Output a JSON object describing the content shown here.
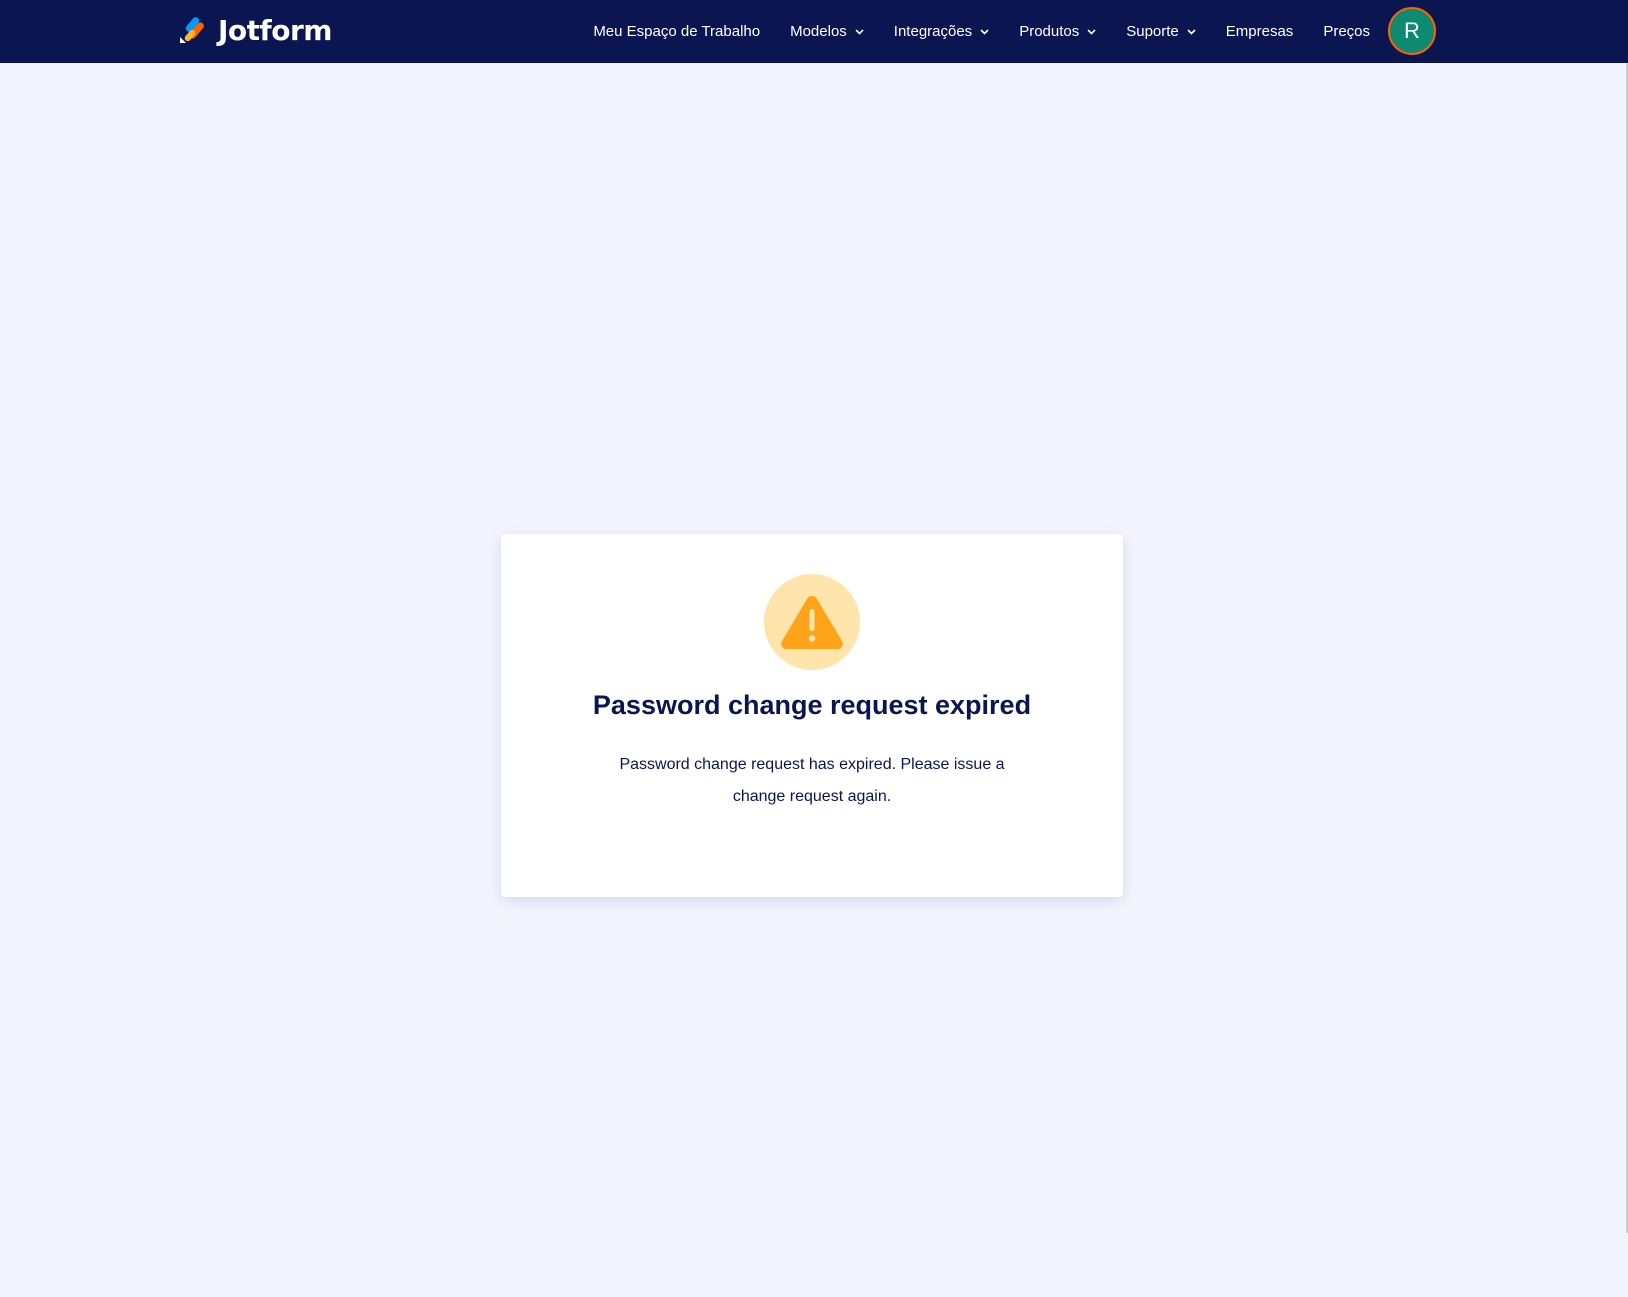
{
  "header": {
    "logo_text": "Jotform",
    "logo_icon": "jotform-logo-icon",
    "nav": [
      {
        "label": "Meu Espaço de Trabalho",
        "dropdown": false
      },
      {
        "label": "Modelos",
        "dropdown": true
      },
      {
        "label": "Integrações",
        "dropdown": true
      },
      {
        "label": "Produtos",
        "dropdown": true
      },
      {
        "label": "Suporte",
        "dropdown": true
      },
      {
        "label": "Empresas",
        "dropdown": false
      },
      {
        "label": "Preços",
        "dropdown": false
      }
    ],
    "avatar_initial": "R"
  },
  "card": {
    "icon": "warning-icon",
    "title": "Password change request expired",
    "message": "Password change request has expired. Please issue a change request again."
  },
  "colors": {
    "header_bg": "#0a1551",
    "page_bg": "#f3f4fe",
    "avatar_bg": "#0e8a73",
    "avatar_border": "#ff6100",
    "warning_circle": "#ffe5ab",
    "warning_triangle": "#ffa31a",
    "text_primary": "#0a1551"
  }
}
